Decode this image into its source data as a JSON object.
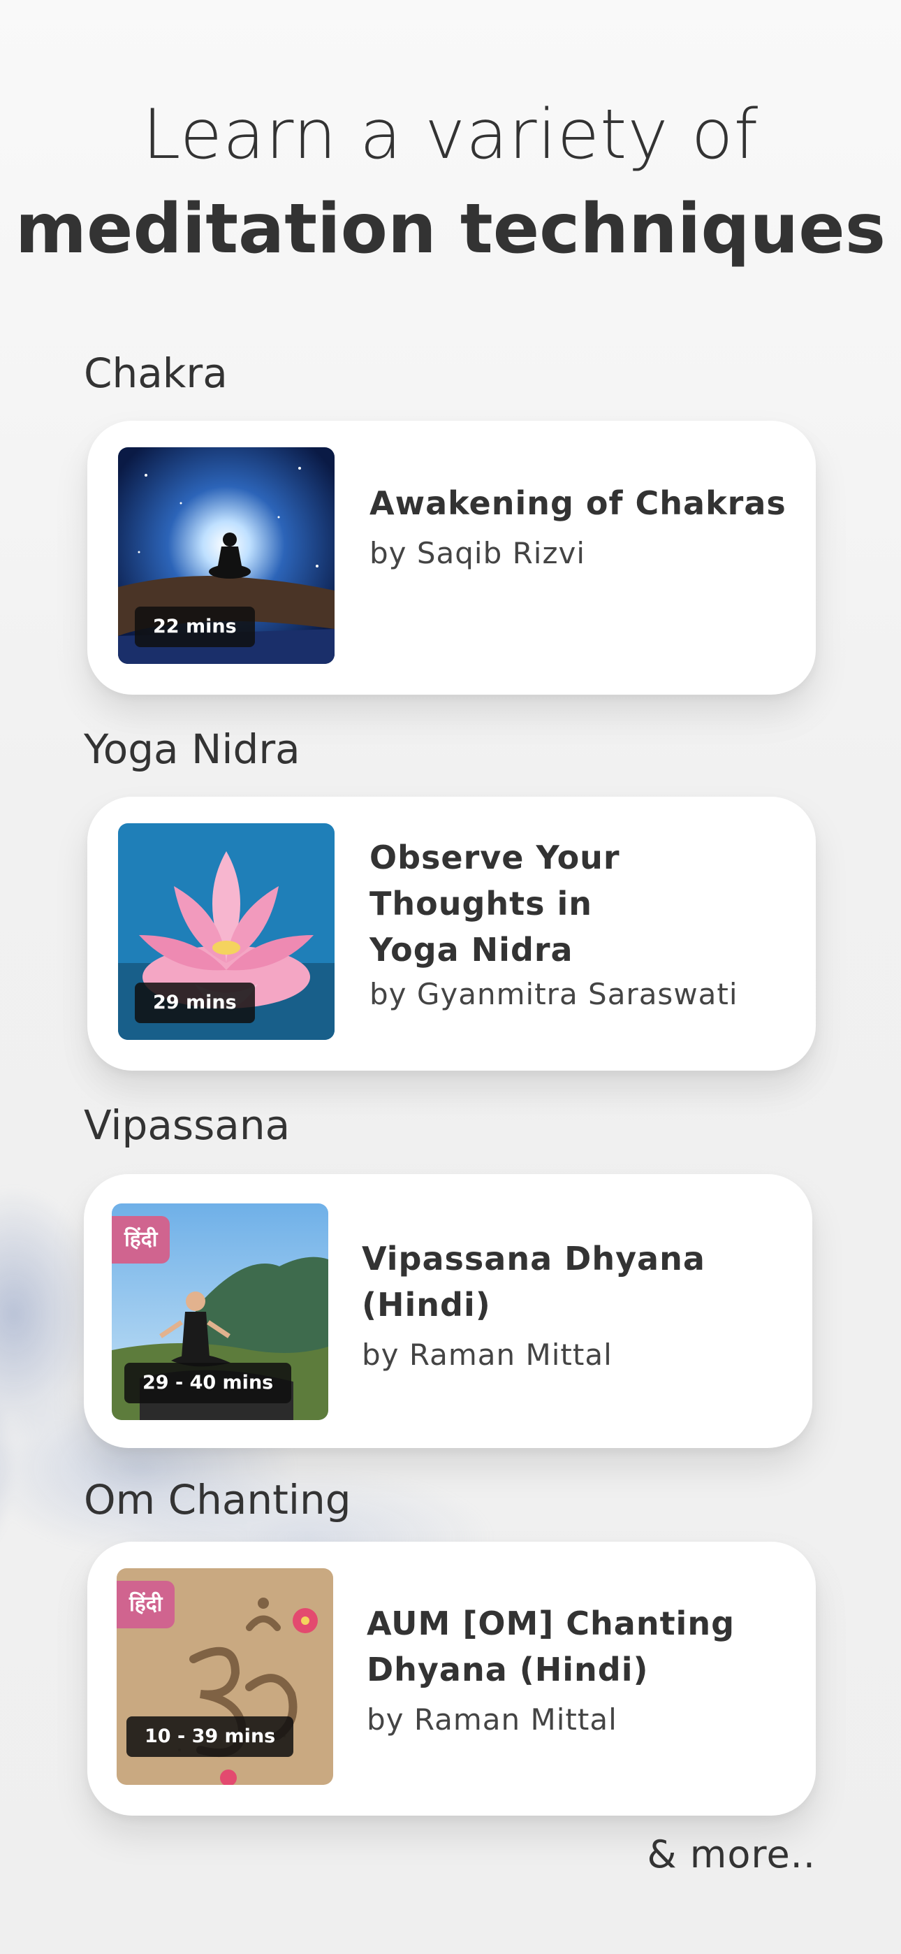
{
  "header": {
    "line1": "Learn a variety of",
    "line2": "meditation techniques"
  },
  "sections": [
    {
      "label": "Chakra",
      "card": {
        "title": "Awakening of Chakras",
        "author": "by Saqib Rizvi",
        "duration": "22 mins",
        "badge": ""
      }
    },
    {
      "label": "Yoga Nidra",
      "card": {
        "title": "Observe Your Thoughts in Yoga Nidra",
        "author": "by Gyanmitra Saraswati",
        "duration": "29 mins",
        "badge": ""
      }
    },
    {
      "label": "Vipassana",
      "card": {
        "title": "Vipassana Dhyana (Hindi)",
        "author": "by Raman Mittal",
        "duration": "29 - 40 mins",
        "badge": "हिंदी"
      }
    },
    {
      "label": "Om Chanting",
      "card": {
        "title": "AUM [OM] Chanting Dhyana (Hindi)",
        "author": "by Raman Mittal",
        "duration": "10 - 39 mins",
        "badge": "हिंदी"
      }
    }
  ],
  "footer": {
    "more": "& more.."
  },
  "colors": {
    "badge": "#d0648f",
    "text": "#333333",
    "card": "#ffffff"
  }
}
